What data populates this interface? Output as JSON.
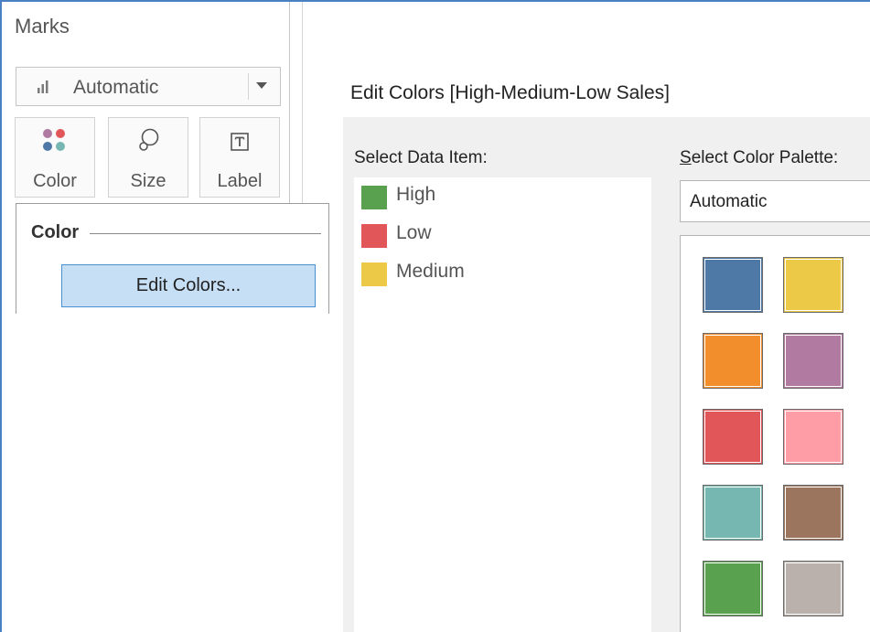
{
  "marks_panel": {
    "title": "Marks",
    "mark_type": {
      "value": "Automatic",
      "icon": "bar-chart-icon"
    },
    "cards": [
      {
        "label": "Color",
        "icon": "color-dots-icon"
      },
      {
        "label": "Size",
        "icon": "size-bubble-icon"
      },
      {
        "label": "Label",
        "icon": "text-label-icon"
      }
    ],
    "color_popup": {
      "heading": "Color",
      "edit_button": "Edit Colors..."
    }
  },
  "dialog": {
    "title": "Edit Colors [High-Medium-Low Sales]",
    "select_data_item_label": "Select Data Item:",
    "select_palette_label": "Select Color Palette:",
    "palette_value": "Automatic",
    "data_items": [
      {
        "label": "High",
        "color": "#59a14f"
      },
      {
        "label": "Low",
        "color": "#e15759"
      },
      {
        "label": "Medium",
        "color": "#edc948"
      }
    ],
    "palette_swatches": [
      "#4e79a7",
      "#edc948",
      "#f28e2b",
      "#b07aa1",
      "#e15759",
      "#ff9da7",
      "#76b7b2",
      "#9c755f",
      "#59a14f",
      "#bab0ac"
    ]
  },
  "colors": {
    "accent_border": "#4a7fc1",
    "button_fill": "#c6dff5",
    "color_icon_dots": [
      "#b07aa1",
      "#e15759",
      "#4e79a7",
      "#76b7b2"
    ]
  }
}
